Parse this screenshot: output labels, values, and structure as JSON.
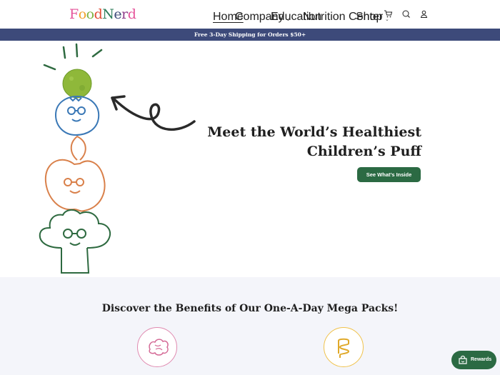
{
  "brand": {
    "logo_text": "FoodNerd",
    "logo_letters": [
      "F",
      "o",
      "o",
      "d",
      "N",
      "e",
      "r",
      "d"
    ],
    "logo_colors": [
      "#e5539a",
      "#f0a22a",
      "#7cb342",
      "#e24b34",
      "#2e7d5b",
      "#3d4a7a",
      "#8e3c8a",
      "#e5539a"
    ]
  },
  "nav": {
    "items": [
      {
        "label": "Home",
        "active": true,
        "has_dropdown": false
      },
      {
        "label": "Company",
        "active": false,
        "has_dropdown": true
      },
      {
        "label": "Education",
        "active": false,
        "has_dropdown": false
      },
      {
        "label": "Nutrition Center",
        "active": false,
        "has_dropdown": true
      },
      {
        "label": "Shop",
        "active": false,
        "has_dropdown": false
      }
    ],
    "icons": [
      "cart-icon",
      "search-icon",
      "account-icon"
    ]
  },
  "announcement": {
    "text": "Free 3-Day Shipping for Orders $50+"
  },
  "hero": {
    "title_line1": "Meet the World’s Healthiest",
    "title_line2": "Children’s Puff",
    "cta_label": "See What’s Inside"
  },
  "benefits": {
    "title": "Discover the Benefits of Our One-A-Day Mega Packs!",
    "icons": [
      "brain-icon",
      "gut-icon"
    ]
  },
  "rewards": {
    "label": "Rewards"
  },
  "colors": {
    "announcement_bg": "#3d4a7a",
    "cta_bg": "#2b6a43",
    "blueberry": "#3a78b6",
    "apple": "#d9804a",
    "broccoli": "#2e6a40",
    "brain_circle": "#e08ab0",
    "gut_circle": "#f0c24a"
  }
}
